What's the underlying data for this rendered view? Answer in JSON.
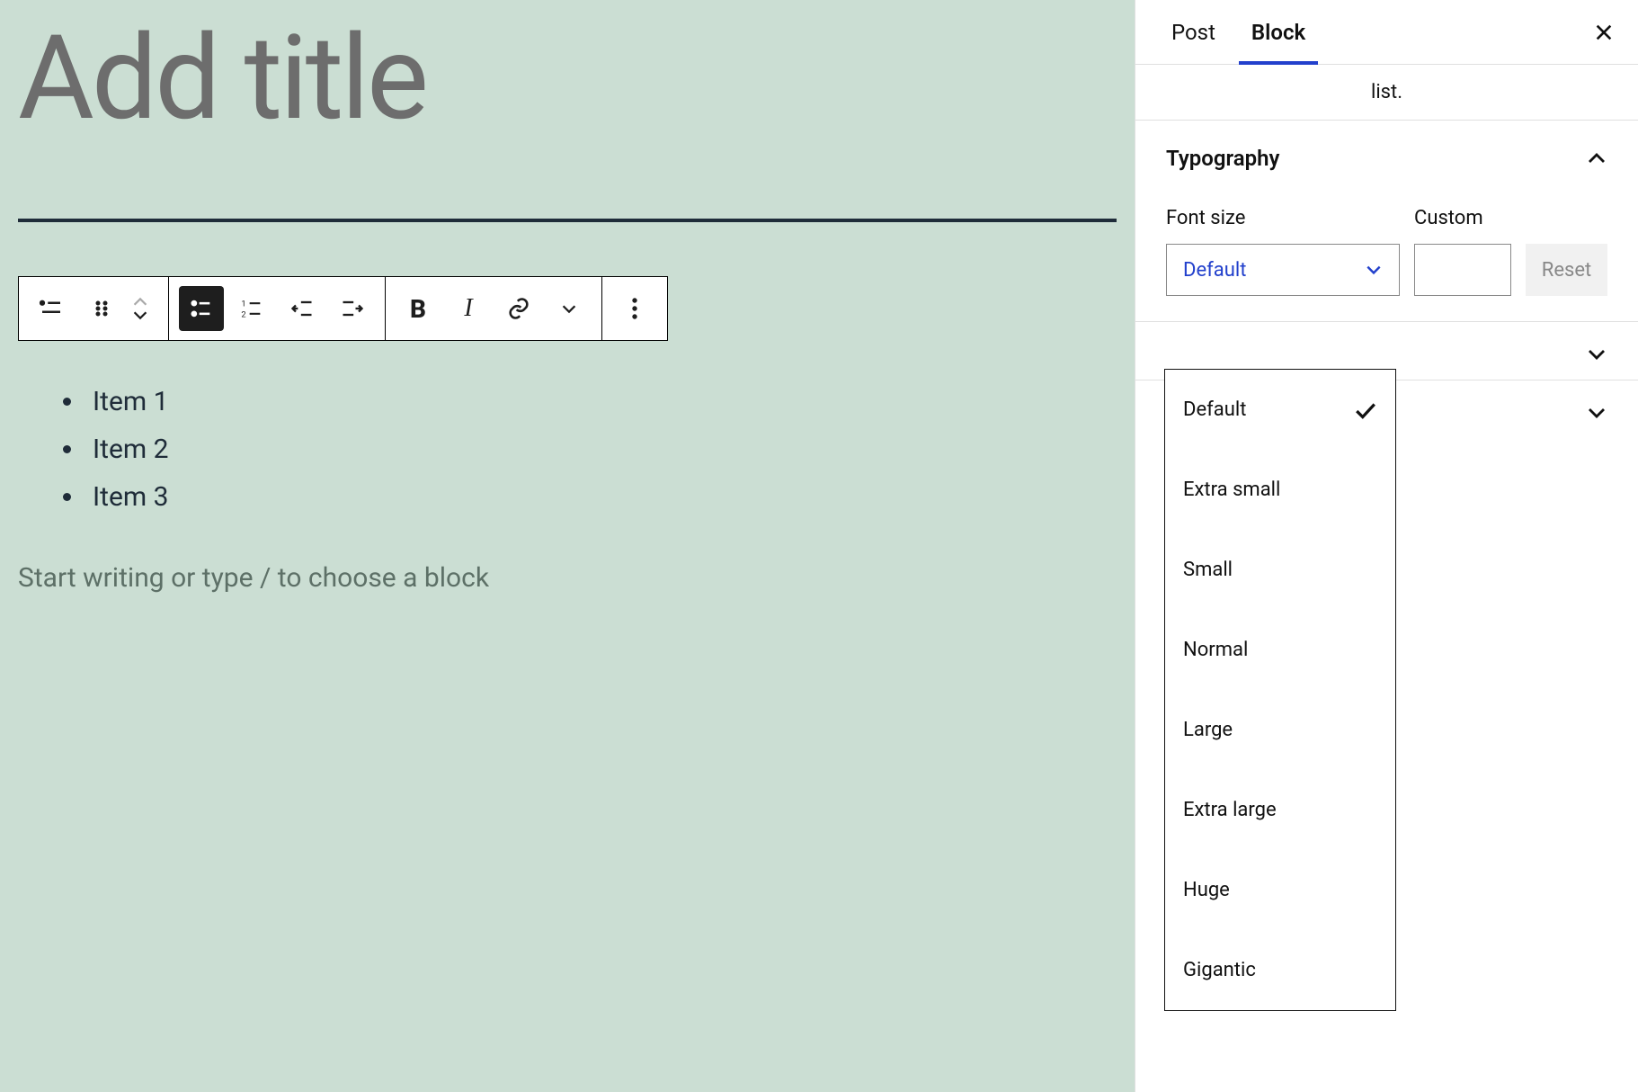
{
  "editor": {
    "title_placeholder": "Add title",
    "list_items": [
      "Item 1",
      "Item 2",
      "Item 3"
    ],
    "paragraph_placeholder": "Start writing or type / to choose a block"
  },
  "sidebar": {
    "tabs": {
      "post": "Post",
      "block": "Block"
    },
    "block_desc": "list.",
    "typography": {
      "title": "Typography",
      "font_size_label": "Font size",
      "custom_label": "Custom",
      "reset_label": "Reset",
      "selected": "Default",
      "options": [
        "Default",
        "Extra small",
        "Small",
        "Normal",
        "Large",
        "Extra large",
        "Huge",
        "Gigantic"
      ]
    }
  }
}
